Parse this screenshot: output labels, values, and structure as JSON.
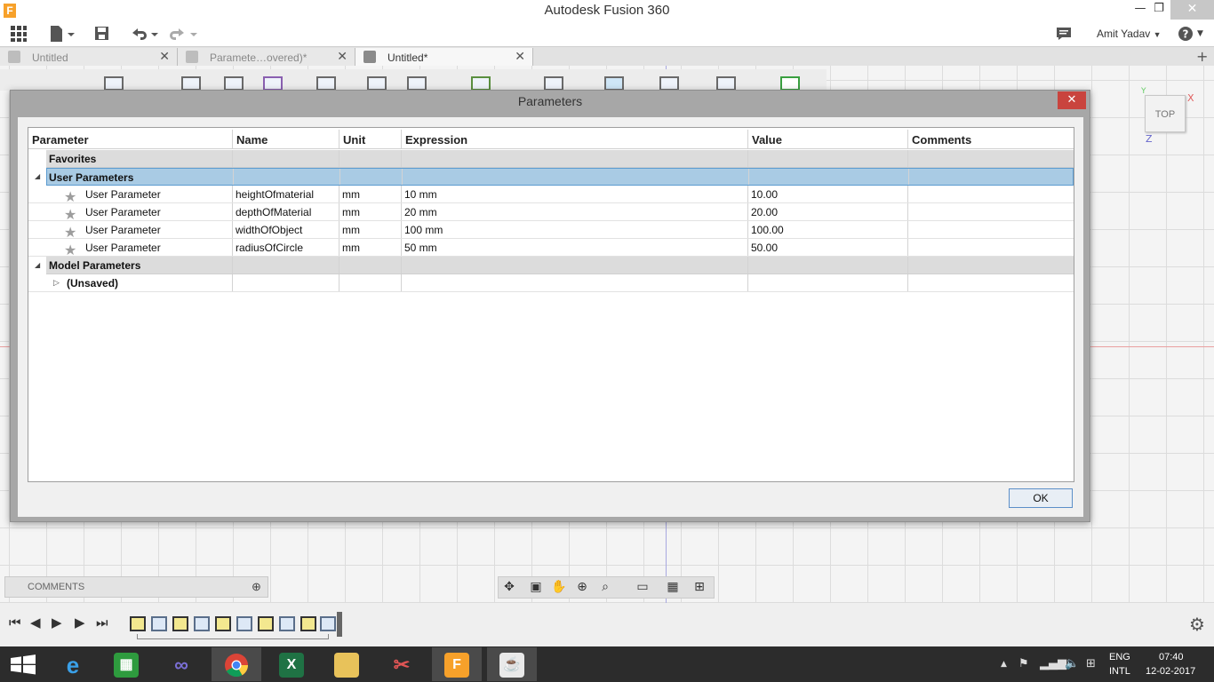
{
  "window": {
    "title": "Autodesk Fusion 360",
    "app_icon_letter": "F",
    "minimize": "—",
    "maximize": "❐",
    "close": "✕"
  },
  "toolbar": {
    "user_name": "Amit Yadav",
    "help": "?"
  },
  "tabs": [
    {
      "label": "Untitled",
      "active": false
    },
    {
      "label": "Paramete…overed)*",
      "active": false
    },
    {
      "label": "Untitled*",
      "active": true
    }
  ],
  "tab_close": "✕",
  "tab_add": "+",
  "viewcube": {
    "face": "TOP",
    "x_axis": "X",
    "z_axis": "Z",
    "y_axis": "Y"
  },
  "dialog": {
    "title": "Parameters",
    "close": "✕",
    "ok_label": "OK",
    "columns": [
      "Parameter",
      "Name",
      "Unit",
      "Expression",
      "Value",
      "Comments"
    ],
    "favorites_label": "Favorites",
    "user_params_label": "User Parameters",
    "user_params": [
      {
        "parameter": "User Parameter",
        "name": "heightOfmaterial",
        "unit": "mm",
        "expression": "10 mm",
        "value": "10.00"
      },
      {
        "parameter": "User Parameter",
        "name": "depthOfMaterial",
        "unit": "mm",
        "expression": "20 mm",
        "value": "20.00"
      },
      {
        "parameter": "User Parameter",
        "name": "widthOfObject",
        "unit": "mm",
        "expression": "100 mm",
        "value": "100.00"
      },
      {
        "parameter": "User Parameter",
        "name": "radiusOfCircle",
        "unit": "mm",
        "expression": "50 mm",
        "value": "50.00"
      }
    ],
    "model_params_label": "Model Parameters",
    "unsaved_label": "(Unsaved)"
  },
  "comments_panel": {
    "label": "COMMENTS",
    "add": "⊕"
  },
  "taskbar": {
    "lang_top": "ENG",
    "lang_bottom": "INTL",
    "time": "07:40",
    "date": "12-02-2017"
  },
  "colors": {
    "selected_row": "#a9cbe4",
    "close_button": "#c9443e",
    "fusion_orange": "#f7a12a"
  }
}
